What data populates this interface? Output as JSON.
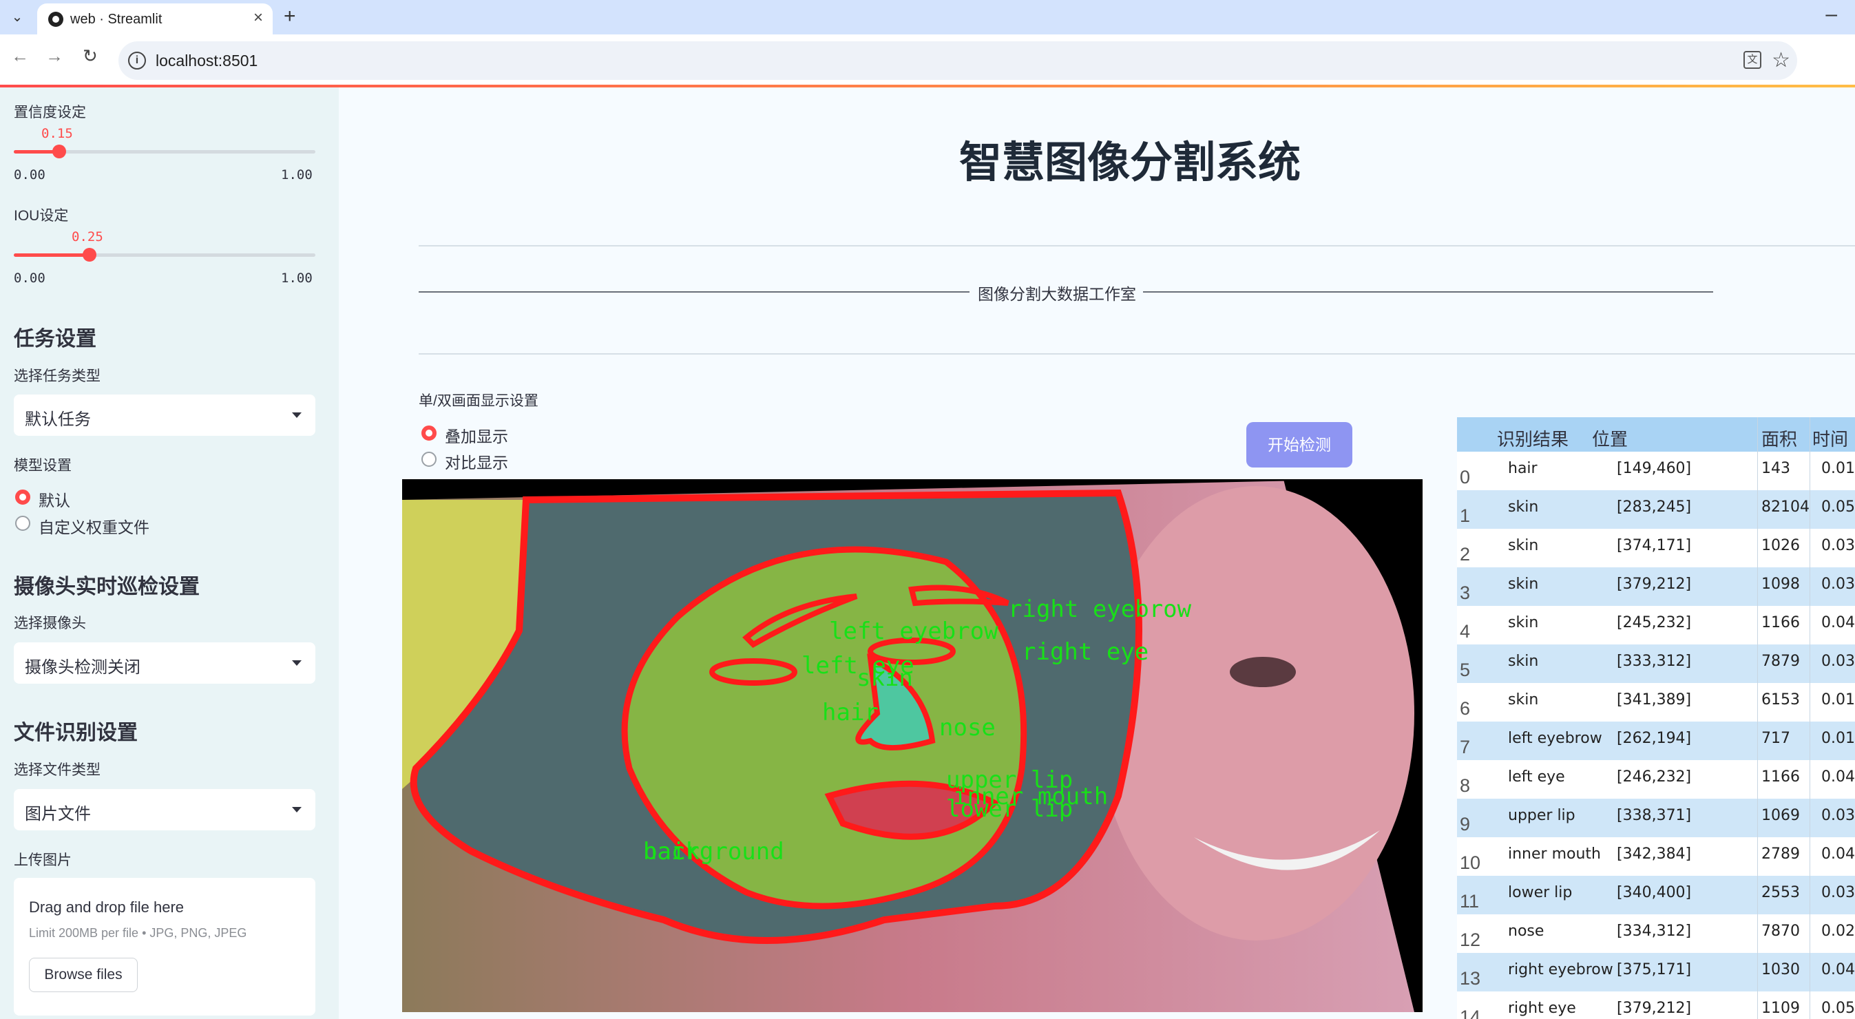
{
  "browser": {
    "tab_title": "web · Streamlit",
    "url": "localhost:8501"
  },
  "sidebar": {
    "confidence": {
      "label": "置信度设定",
      "value": "0.15",
      "value_fraction": 0.15,
      "min": "0.00",
      "max": "1.00"
    },
    "iou": {
      "label": "IOU设定",
      "value": "0.25",
      "value_fraction": 0.25,
      "min": "0.00",
      "max": "1.00"
    },
    "task_settings": {
      "heading": "任务设置",
      "label": "选择任务类型",
      "selected": "默认任务"
    },
    "model_settings": {
      "label": "模型设置",
      "options": [
        "默认",
        "自定义权重文件"
      ],
      "selected_index": 0
    },
    "camera": {
      "heading": "摄像头实时巡检设置",
      "label": "选择摄像头",
      "selected": "摄像头检测关闭"
    },
    "file_settings": {
      "heading": "文件识别设置",
      "label": "选择文件类型",
      "selected": "图片文件"
    },
    "upload": {
      "label": "上传图片",
      "drop_text": "Drag and drop file here",
      "limit_text": "Limit 200MB per file • JPG, PNG, JPEG",
      "browse_label": "Browse files"
    }
  },
  "main": {
    "title": "智慧图像分割系统",
    "banner": "图像分割大数据工作室",
    "display_mode": {
      "label": "单/双画面显示设置",
      "options": [
        "叠加显示",
        "对比显示"
      ],
      "selected_index": 0
    },
    "start_button": "开始检测"
  },
  "image_overlay_labels": [
    "right eyebrow",
    "left eyebrow",
    "right eye",
    "left eye",
    "skin",
    "hair",
    "nose",
    "upper lip",
    "inner mouth",
    "lower lip",
    "background",
    "hair"
  ],
  "colors": {
    "accent": "#ff4b4b",
    "mask_green": "#7ccb3c",
    "contour_red": "#ff1a1a",
    "label_green": "#18e018",
    "button": "#8e95f2",
    "table_header": "#a9d3f4",
    "table_alt_row": "#cfe6f8"
  },
  "results_table": {
    "headers": [
      "识别结果",
      "位置",
      "面积",
      "时间"
    ],
    "rows": [
      {
        "idx": "0",
        "result": "hair",
        "pos": "[149,460]",
        "area": "143",
        "time": "0.01"
      },
      {
        "idx": "1",
        "result": "skin",
        "pos": "[283,245]",
        "area": "82104",
        "time": "0.05"
      },
      {
        "idx": "2",
        "result": "skin",
        "pos": "[374,171]",
        "area": "1026",
        "time": "0.03"
      },
      {
        "idx": "3",
        "result": "skin",
        "pos": "[379,212]",
        "area": "1098",
        "time": "0.03"
      },
      {
        "idx": "4",
        "result": "skin",
        "pos": "[245,232]",
        "area": "1166",
        "time": "0.04"
      },
      {
        "idx": "5",
        "result": "skin",
        "pos": "[333,312]",
        "area": "7879",
        "time": "0.03"
      },
      {
        "idx": "6",
        "result": "skin",
        "pos": "[341,389]",
        "area": "6153",
        "time": "0.01"
      },
      {
        "idx": "7",
        "result": "left eyebrow",
        "pos": "[262,194]",
        "area": "717",
        "time": "0.01"
      },
      {
        "idx": "8",
        "result": "left eye",
        "pos": "[246,232]",
        "area": "1166",
        "time": "0.04"
      },
      {
        "idx": "9",
        "result": "upper lip",
        "pos": "[338,371]",
        "area": "1069",
        "time": "0.03"
      },
      {
        "idx": "10",
        "result": "inner mouth",
        "pos": "[342,384]",
        "area": "2789",
        "time": "0.04"
      },
      {
        "idx": "11",
        "result": "lower lip",
        "pos": "[340,400]",
        "area": "2553",
        "time": "0.03"
      },
      {
        "idx": "12",
        "result": "nose",
        "pos": "[334,312]",
        "area": "7870",
        "time": "0.02"
      },
      {
        "idx": "13",
        "result": "right eyebrow",
        "pos": "[375,171]",
        "area": "1030",
        "time": "0.04"
      },
      {
        "idx": "14",
        "result": "right eye",
        "pos": "[379,212]",
        "area": "1109",
        "time": "0.05"
      }
    ]
  }
}
